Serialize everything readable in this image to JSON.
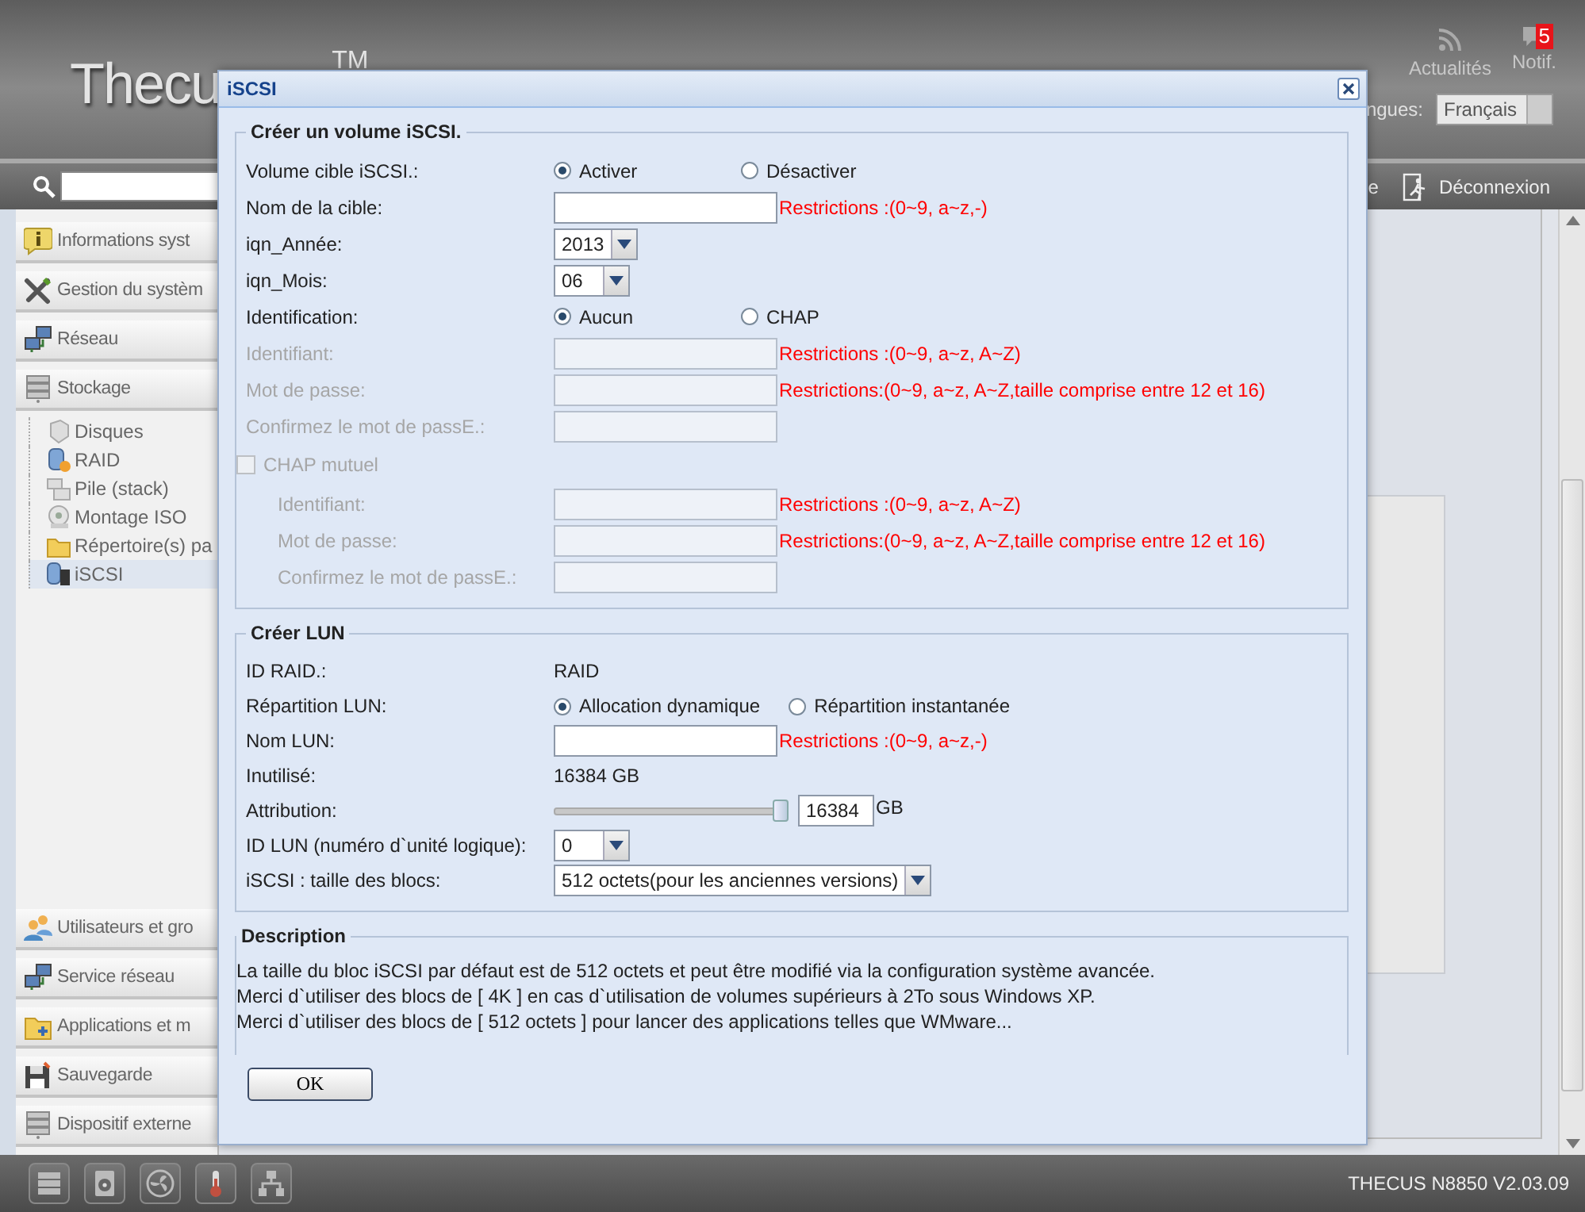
{
  "header": {
    "logo": "Thecu",
    "logo_mark": "TM",
    "actions": [
      {
        "label": "Actualités"
      },
      {
        "label": "Notif.",
        "badge": "5"
      }
    ],
    "language_label": "ngues:",
    "language": "Français"
  },
  "toolbar": {
    "partial_label": "e",
    "logout": "Déconnexion"
  },
  "sidebar": {
    "items": [
      {
        "label": "Informations syst"
      },
      {
        "label": "Gestion du systèm"
      },
      {
        "label": "Réseau"
      },
      {
        "label": "Stockage",
        "children": [
          {
            "label": "Disques",
            "selected": false
          },
          {
            "label": "RAID",
            "selected": false
          },
          {
            "label": "Pile (stack)",
            "selected": false
          },
          {
            "label": "Montage ISO",
            "selected": false
          },
          {
            "label": "Répertoire(s) pa",
            "selected": false
          },
          {
            "label": "iSCSI",
            "selected": true
          }
        ]
      }
    ],
    "lower_items": [
      {
        "label": "Utilisateurs et gro"
      },
      {
        "label": "Service réseau"
      },
      {
        "label": "Applications et m"
      },
      {
        "label": "Sauvegarde"
      },
      {
        "label": "Dispositif externe"
      }
    ]
  },
  "status_bar": {
    "model": "THECUS N8850 V2.03.09"
  },
  "dialog": {
    "title": "iSCSI",
    "sections": [
      {
        "title": "Créer un volume iSCSI.",
        "rows": [
          {
            "kind": "radio",
            "label": "Volume cible iSCSI.:",
            "options": [
              {
                "label": "Activer",
                "selected": true
              },
              {
                "label": "Désactiver",
                "selected": false
              }
            ]
          },
          {
            "kind": "input",
            "label": "Nom de la cible:",
            "disabled": false,
            "hint": "Restrictions :(0~9, a~z,-)"
          },
          {
            "kind": "select",
            "label": "iqn_Année:",
            "value": "2013"
          },
          {
            "kind": "select",
            "label": "iqn_Mois:",
            "value": "06"
          },
          {
            "kind": "radio",
            "label": "Identification:",
            "options": [
              {
                "label": "Aucun",
                "selected": true
              },
              {
                "label": "CHAP",
                "selected": false
              }
            ]
          },
          {
            "kind": "input",
            "label": "Identifiant:",
            "disabled": true,
            "hint": "Restrictions :(0~9, a~z, A~Z)"
          },
          {
            "kind": "input",
            "label": "Mot de passe:",
            "disabled": true,
            "hint": "Restrictions:(0~9, a~z, A~Z,taille comprise entre 12 et 16)"
          },
          {
            "kind": "input",
            "label": "Confirmez le mot de passE.:",
            "disabled": true
          },
          {
            "kind": "checkbox",
            "label": "CHAP mutuel",
            "checked": false,
            "disabled": true,
            "children": [
              {
                "kind": "input",
                "label": "Identifiant:",
                "disabled": true,
                "hint": "Restrictions :(0~9, a~z, A~Z)"
              },
              {
                "kind": "input",
                "label": "Mot de passe:",
                "disabled": true,
                "hint": "Restrictions:(0~9, a~z, A~Z,taille comprise entre 12 et 16)"
              },
              {
                "kind": "input",
                "label": "Confirmez le mot de passE.:",
                "disabled": true
              }
            ]
          }
        ]
      },
      {
        "title": "Créer LUN",
        "rows": [
          {
            "kind": "value",
            "label": "ID RAID.:",
            "value": "RAID"
          },
          {
            "kind": "radio",
            "label": "Répartition LUN:",
            "options": [
              {
                "label": "Allocation dynamique",
                "selected": true
              },
              {
                "label": "Répartition instantanée",
                "selected": false
              }
            ]
          },
          {
            "kind": "input",
            "label": "Nom LUN:",
            "disabled": false,
            "hint": "Restrictions :(0~9, a~z,-)"
          },
          {
            "kind": "value",
            "label": "Inutilisé:",
            "value": "16384 GB"
          },
          {
            "kind": "slider",
            "label": "Attribution:",
            "level": 1.0,
            "value": "16384",
            "unit": "GB"
          },
          {
            "kind": "select",
            "label": "ID LUN (numéro d`unité logique):",
            "value": "0"
          },
          {
            "kind": "select",
            "label": "iSCSI : taille des blocs:",
            "value": "512 octets(pour les anciennes versions)"
          }
        ]
      }
    ],
    "description": {
      "title": "Description",
      "lines": [
        "La taille du bloc iSCSI par défaut est de 512 octets et peut être modifié via la configuration système avancée.",
        "Merci d`utiliser des blocs de [ 4K ] en cas d`utilisation de volumes supérieurs à 2To sous Windows XP.",
        "Merci d`utiliser des blocs de [ 512 octets ] pour lancer des applications telles que WMware..."
      ]
    },
    "buttons": [
      "OK"
    ]
  }
}
